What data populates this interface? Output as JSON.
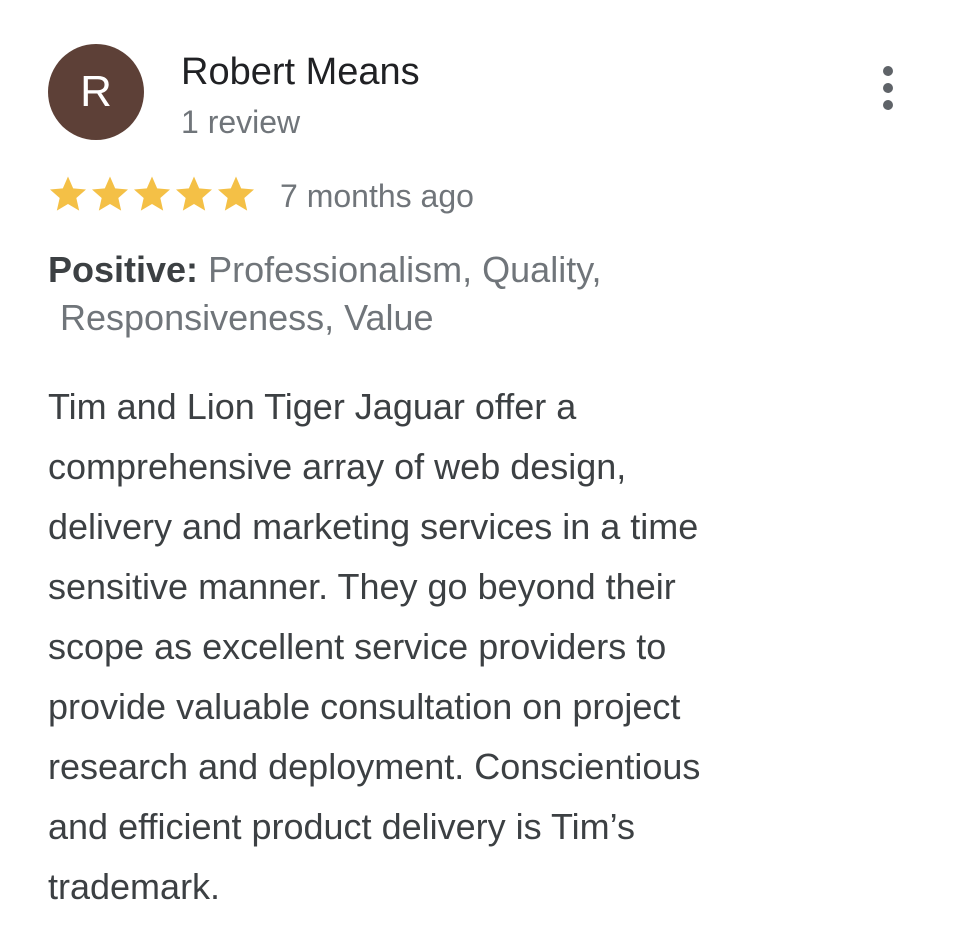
{
  "review": {
    "author": {
      "initial": "R",
      "name": "Robert Means",
      "review_count": "1 review",
      "avatar_color": "#5d4037"
    },
    "rating": {
      "stars": 5,
      "max_stars": 5,
      "star_color": "#f4c046"
    },
    "date": "7 months ago",
    "highlights": {
      "label": "Positive:",
      "line1": "Professionalism, Quality,",
      "line2": "Responsiveness, Value"
    },
    "text": "Tim and Lion Tiger Jaguar offer a\ncomprehensive array of web design,\ndelivery and marketing services in a time\nsensitive manner. They go beyond their\nscope as excellent service providers to\nprovide valuable consultation on project\nresearch and deployment. Conscientious\nand efficient product delivery is Tim’s\ntrademark.",
    "more_icon": "more-vert-icon"
  }
}
